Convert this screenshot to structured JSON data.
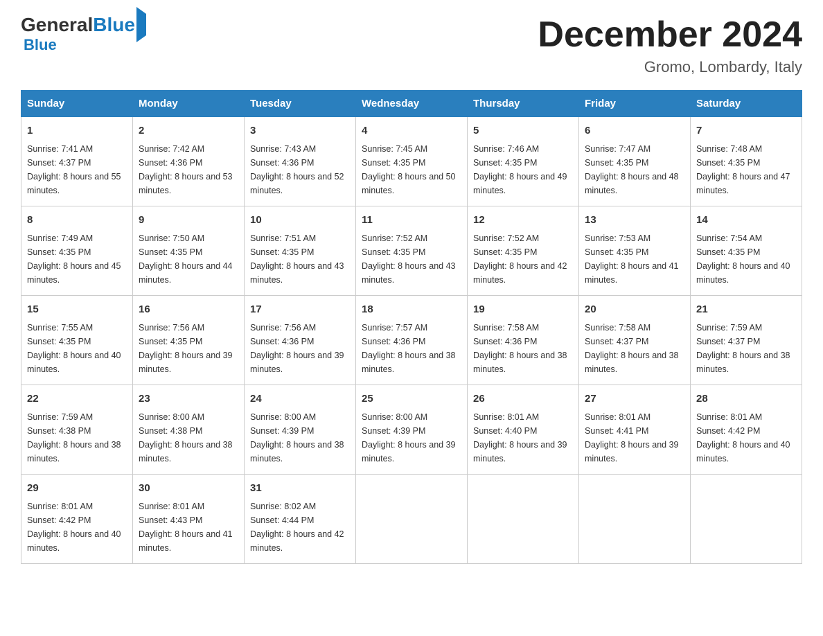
{
  "header": {
    "logo_general": "General",
    "logo_blue": "Blue",
    "title": "December 2024",
    "subtitle": "Gromo, Lombardy, Italy"
  },
  "days": [
    "Sunday",
    "Monday",
    "Tuesday",
    "Wednesday",
    "Thursday",
    "Friday",
    "Saturday"
  ],
  "weeks": [
    [
      {
        "num": "1",
        "sunrise": "7:41 AM",
        "sunset": "4:37 PM",
        "daylight": "8 hours and 55 minutes."
      },
      {
        "num": "2",
        "sunrise": "7:42 AM",
        "sunset": "4:36 PM",
        "daylight": "8 hours and 53 minutes."
      },
      {
        "num": "3",
        "sunrise": "7:43 AM",
        "sunset": "4:36 PM",
        "daylight": "8 hours and 52 minutes."
      },
      {
        "num": "4",
        "sunrise": "7:45 AM",
        "sunset": "4:35 PM",
        "daylight": "8 hours and 50 minutes."
      },
      {
        "num": "5",
        "sunrise": "7:46 AM",
        "sunset": "4:35 PM",
        "daylight": "8 hours and 49 minutes."
      },
      {
        "num": "6",
        "sunrise": "7:47 AM",
        "sunset": "4:35 PM",
        "daylight": "8 hours and 48 minutes."
      },
      {
        "num": "7",
        "sunrise": "7:48 AM",
        "sunset": "4:35 PM",
        "daylight": "8 hours and 47 minutes."
      }
    ],
    [
      {
        "num": "8",
        "sunrise": "7:49 AM",
        "sunset": "4:35 PM",
        "daylight": "8 hours and 45 minutes."
      },
      {
        "num": "9",
        "sunrise": "7:50 AM",
        "sunset": "4:35 PM",
        "daylight": "8 hours and 44 minutes."
      },
      {
        "num": "10",
        "sunrise": "7:51 AM",
        "sunset": "4:35 PM",
        "daylight": "8 hours and 43 minutes."
      },
      {
        "num": "11",
        "sunrise": "7:52 AM",
        "sunset": "4:35 PM",
        "daylight": "8 hours and 43 minutes."
      },
      {
        "num": "12",
        "sunrise": "7:52 AM",
        "sunset": "4:35 PM",
        "daylight": "8 hours and 42 minutes."
      },
      {
        "num": "13",
        "sunrise": "7:53 AM",
        "sunset": "4:35 PM",
        "daylight": "8 hours and 41 minutes."
      },
      {
        "num": "14",
        "sunrise": "7:54 AM",
        "sunset": "4:35 PM",
        "daylight": "8 hours and 40 minutes."
      }
    ],
    [
      {
        "num": "15",
        "sunrise": "7:55 AM",
        "sunset": "4:35 PM",
        "daylight": "8 hours and 40 minutes."
      },
      {
        "num": "16",
        "sunrise": "7:56 AM",
        "sunset": "4:35 PM",
        "daylight": "8 hours and 39 minutes."
      },
      {
        "num": "17",
        "sunrise": "7:56 AM",
        "sunset": "4:36 PM",
        "daylight": "8 hours and 39 minutes."
      },
      {
        "num": "18",
        "sunrise": "7:57 AM",
        "sunset": "4:36 PM",
        "daylight": "8 hours and 38 minutes."
      },
      {
        "num": "19",
        "sunrise": "7:58 AM",
        "sunset": "4:36 PM",
        "daylight": "8 hours and 38 minutes."
      },
      {
        "num": "20",
        "sunrise": "7:58 AM",
        "sunset": "4:37 PM",
        "daylight": "8 hours and 38 minutes."
      },
      {
        "num": "21",
        "sunrise": "7:59 AM",
        "sunset": "4:37 PM",
        "daylight": "8 hours and 38 minutes."
      }
    ],
    [
      {
        "num": "22",
        "sunrise": "7:59 AM",
        "sunset": "4:38 PM",
        "daylight": "8 hours and 38 minutes."
      },
      {
        "num": "23",
        "sunrise": "8:00 AM",
        "sunset": "4:38 PM",
        "daylight": "8 hours and 38 minutes."
      },
      {
        "num": "24",
        "sunrise": "8:00 AM",
        "sunset": "4:39 PM",
        "daylight": "8 hours and 38 minutes."
      },
      {
        "num": "25",
        "sunrise": "8:00 AM",
        "sunset": "4:39 PM",
        "daylight": "8 hours and 39 minutes."
      },
      {
        "num": "26",
        "sunrise": "8:01 AM",
        "sunset": "4:40 PM",
        "daylight": "8 hours and 39 minutes."
      },
      {
        "num": "27",
        "sunrise": "8:01 AM",
        "sunset": "4:41 PM",
        "daylight": "8 hours and 39 minutes."
      },
      {
        "num": "28",
        "sunrise": "8:01 AM",
        "sunset": "4:42 PM",
        "daylight": "8 hours and 40 minutes."
      }
    ],
    [
      {
        "num": "29",
        "sunrise": "8:01 AM",
        "sunset": "4:42 PM",
        "daylight": "8 hours and 40 minutes."
      },
      {
        "num": "30",
        "sunrise": "8:01 AM",
        "sunset": "4:43 PM",
        "daylight": "8 hours and 41 minutes."
      },
      {
        "num": "31",
        "sunrise": "8:02 AM",
        "sunset": "4:44 PM",
        "daylight": "8 hours and 42 minutes."
      },
      null,
      null,
      null,
      null
    ]
  ],
  "labels": {
    "sunrise": "Sunrise:",
    "sunset": "Sunset:",
    "daylight": "Daylight:"
  }
}
